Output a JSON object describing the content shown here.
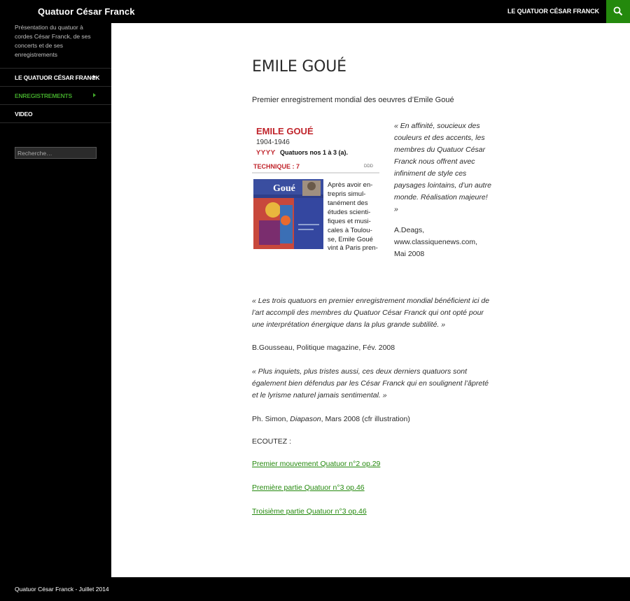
{
  "header": {
    "site_title": "Quatuor César Franck",
    "nav_link": "LE QUATUOR CÉSAR FRANCK",
    "accent_color": "#24890d"
  },
  "sidebar": {
    "description": "Présentation du quatuor à cordes César Franck, de ses concerts et de ses enregistrements",
    "items": [
      {
        "label": "LE QUATUOR CÉSAR FRANCK",
        "has_submenu": true,
        "current": false
      },
      {
        "label": "ENREGISTREMENTS",
        "has_submenu": true,
        "current": true
      },
      {
        "label": "VIDEO",
        "has_submenu": false,
        "current": false
      }
    ],
    "search_placeholder": "Recherche…"
  },
  "main": {
    "title": "EMILE GOUÉ",
    "intro": "Premier enregistrement mondial des oeuvres d’Emile Goué",
    "album_clipping": {
      "header_name": "EMILE GOUÉ",
      "years": "1904-1946",
      "rating": "ƳƳƳƳ",
      "works": "Quatuors nos 1 à 3 (a).",
      "technique": "TECHNIQUE : 7",
      "ddd": "DDD",
      "cover_name": "Goué",
      "column_text": "Après avoir entrepris simultanément des études scientifiques et musicales à Toulouse, Emile Goué vint à Paris pren-"
    },
    "quote1": "« En affinité, soucieux des couleurs et des accents, les membres du Quatuor César Franck nous offrent avec infiniment de style ces paysages lointains, d’un autre monde. Réalisation majeure! »",
    "credit1_name": "A.Deags,",
    "credit1_site": "www.classiquenews.com,",
    "credit1_date": "Mai 2008",
    "quote2": "« Les trois quatuors en premier enregistrement mondial bénéficient ici de l’art accompli des membres du Quatuor César Franck qui ont opté pour une interprétation énergique dans la plus grande subtilité. »",
    "credit2": "B.Gousseau, Politique magazine, Fév. 2008",
    "quote3": "« Plus inquiets, plus tristes aussi, ces deux derniers quatuors sont également bien défendus par les César Franck qui en soulignent l’âpreté et le lyrisme naturel jamais sentimental. »",
    "credit3_prefix": "Ph. Simon, ",
    "credit3_magazine": "Diapason",
    "credit3_suffix": ", Mars 2008 (cfr illustration)",
    "listen_label": "ECOUTEZ :",
    "links": [
      "Premier mouvement Quatuor n°2 op.29",
      "Première partie Quatuor n°3 op.46",
      "Troisième partie Quatuor n°3 op.46"
    ]
  },
  "footer": {
    "text": "Quatuor César Franck - Juillet 2014"
  }
}
